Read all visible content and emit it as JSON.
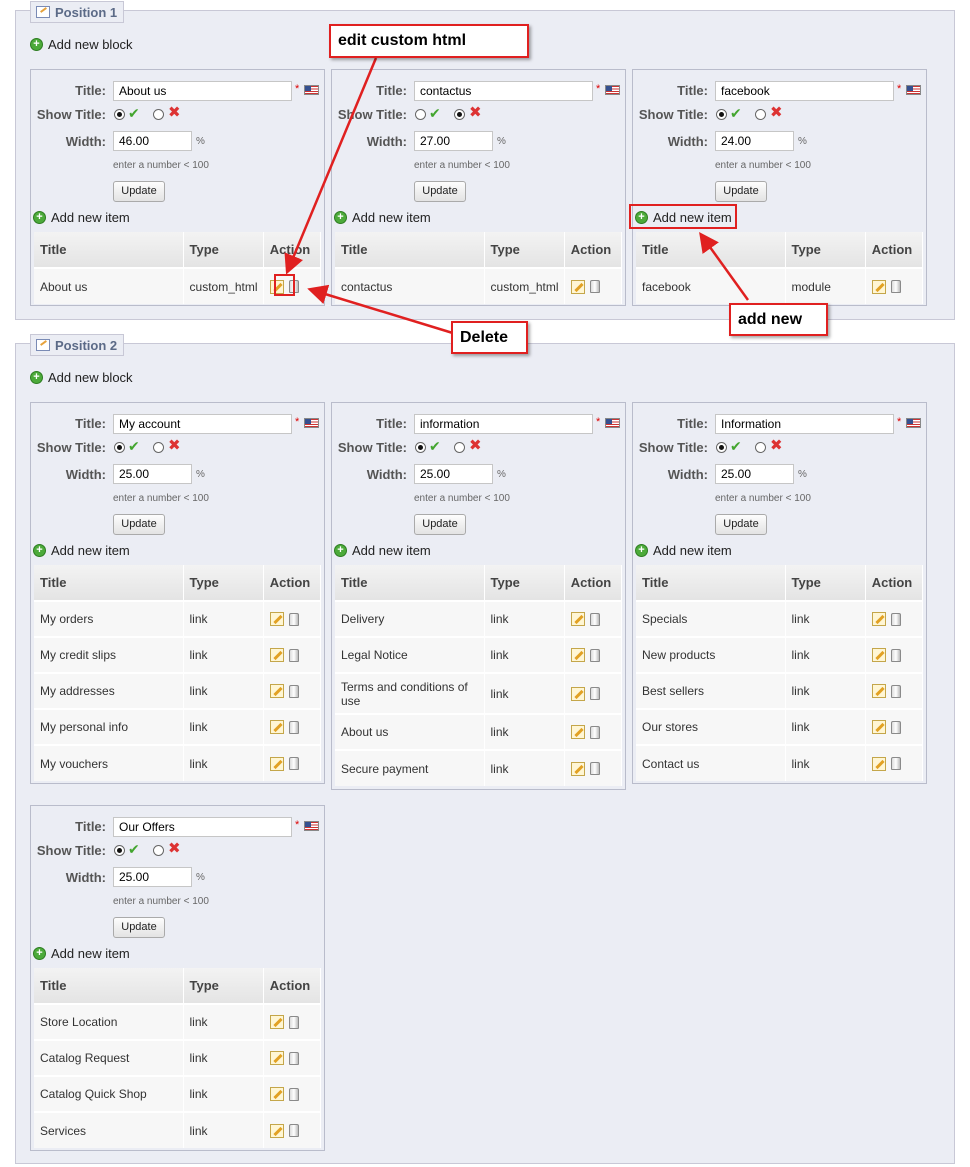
{
  "labels": {
    "title": "Title:",
    "show_title": "Show Title:",
    "width": "Width:",
    "pct": "%",
    "hint": "enter a number < 100",
    "update": "Update",
    "add_item": "Add new item",
    "add_block": "Add new block",
    "col_title": "Title",
    "col_type": "Type",
    "col_action": "Action",
    "required": "*"
  },
  "positions": [
    {
      "legend": "Position 1",
      "blocks": [
        {
          "title": "About us",
          "show_title": true,
          "width": "46.00",
          "items": [
            {
              "title": "About us",
              "type": "custom_html"
            }
          ]
        },
        {
          "title": "contactus",
          "show_title": false,
          "width": "27.00",
          "items": [
            {
              "title": "contactus",
              "type": "custom_html"
            }
          ]
        },
        {
          "title": "facebook",
          "show_title": true,
          "width": "24.00",
          "items": [
            {
              "title": "facebook",
              "type": "module"
            }
          ]
        }
      ]
    },
    {
      "legend": "Position 2",
      "blocks": [
        {
          "title": "My account",
          "show_title": true,
          "width": "25.00",
          "items": [
            {
              "title": "My orders",
              "type": "link"
            },
            {
              "title": "My credit slips",
              "type": "link"
            },
            {
              "title": "My addresses",
              "type": "link"
            },
            {
              "title": "My personal info",
              "type": "link"
            },
            {
              "title": "My vouchers",
              "type": "link"
            }
          ]
        },
        {
          "title": "information",
          "show_title": true,
          "width": "25.00",
          "items": [
            {
              "title": "Delivery",
              "type": "link"
            },
            {
              "title": "Legal Notice",
              "type": "link"
            },
            {
              "title": "Terms and conditions of use",
              "type": "link"
            },
            {
              "title": "About us",
              "type": "link"
            },
            {
              "title": "Secure payment",
              "type": "link"
            }
          ]
        },
        {
          "title": "Information",
          "show_title": true,
          "width": "25.00",
          "items": [
            {
              "title": "Specials",
              "type": "link"
            },
            {
              "title": "New products",
              "type": "link"
            },
            {
              "title": "Best sellers",
              "type": "link"
            },
            {
              "title": "Our stores",
              "type": "link"
            },
            {
              "title": "Contact us",
              "type": "link"
            }
          ]
        },
        {
          "title": "Our Offers",
          "show_title": true,
          "width": "25.00",
          "items": [
            {
              "title": "Store Location",
              "type": "link"
            },
            {
              "title": "Catalog Request",
              "type": "link"
            },
            {
              "title": "Catalog Quick Shop",
              "type": "link"
            },
            {
              "title": "Services",
              "type": "link"
            }
          ]
        }
      ]
    }
  ],
  "annotations": {
    "edit": "edit custom html",
    "delete": "Delete",
    "add_new": "add new"
  },
  "colors": {
    "callout_border": "#e02020",
    "panel_bg": "#ebedf4",
    "check": "#43a52f",
    "cross": "#dd3333"
  }
}
